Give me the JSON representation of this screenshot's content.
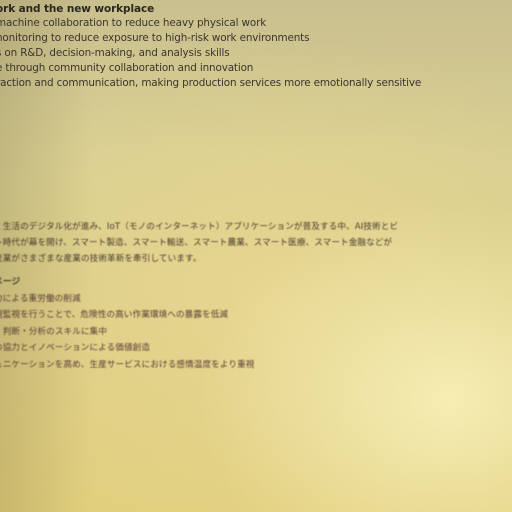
{
  "english": {
    "heading": "ork and the new workplace",
    "items": [
      "machine collaboration to reduce heavy physical work",
      "nonitoring to reduce exposure to high-risk work environments",
      "s on R&D, decision-making, and analysis skills",
      "e through community collaboration and innovation",
      "raction and communication, making production services more emotionally sensitive"
    ]
  },
  "japanese": {
    "paragraph": [
      "く生活のデジタル化が進み、IoT（モノのインターネット）アプリケーションが普及する中、AI技術とビ",
      "ト時代が幕を開け、スマート製造、スマート輸送、スマート農業、スマート医療、スマート金融などが",
      "産業がさまざまな産業の技術革新を牽引しています。"
    ],
    "heading": "メージ",
    "items": [
      "力による重労働の削減",
      "視監視を行うことで、危険性の高い作業環境への暴露を低減",
      "・判断・分析のスキルに集中",
      "の協力とイノベーションによる価値創造",
      "ュニケーションを高め、生産サービスにおける感情温度をより重視"
    ]
  }
}
